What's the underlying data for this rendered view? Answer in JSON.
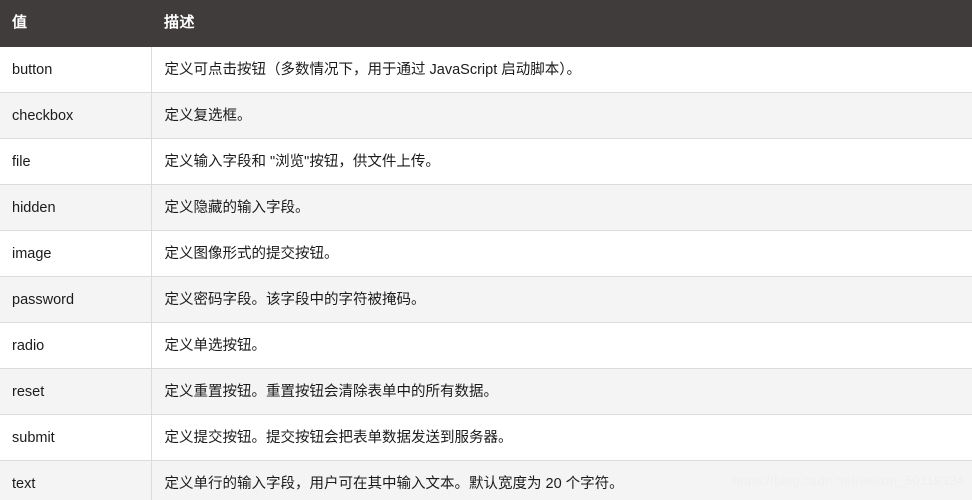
{
  "table": {
    "headers": {
      "value": "值",
      "description": "描述"
    },
    "rows": [
      {
        "value": "button",
        "description": "定义可点击按钮（多数情况下，用于通过 JavaScript 启动脚本）。",
        "striped": false
      },
      {
        "value": "checkbox",
        "description": "定义复选框。",
        "striped": true
      },
      {
        "value": "file",
        "description": "定义输入字段和 \"浏览\"按钮，供文件上传。",
        "striped": false
      },
      {
        "value": "hidden",
        "description": "定义隐藏的输入字段。",
        "striped": true
      },
      {
        "value": "image",
        "description": "定义图像形式的提交按钮。",
        "striped": false
      },
      {
        "value": "password",
        "description": "定义密码字段。该字段中的字符被掩码。",
        "striped": true
      },
      {
        "value": "radio",
        "description": "定义单选按钮。",
        "striped": false
      },
      {
        "value": "reset",
        "description": "定义重置按钮。重置按钮会清除表单中的所有数据。",
        "striped": true
      },
      {
        "value": "submit",
        "description": "定义提交按钮。提交按钮会把表单数据发送到服务器。",
        "striped": false
      },
      {
        "value": "text",
        "description": "定义单行的输入字段，用户可在其中输入文本。默认宽度为 20 个字符。",
        "striped": true
      }
    ]
  },
  "watermark": {
    "text": "https://blog.csdn.net/weixin_50119334"
  },
  "colors": {
    "header_background": "#403c3b",
    "header_text": "#ffffff",
    "row_background": "#ffffff",
    "row_striped_background": "#f4f4f4",
    "border": "#dcdcdc",
    "body_text": "#1b1b1b",
    "watermark_text": "#efefef"
  }
}
